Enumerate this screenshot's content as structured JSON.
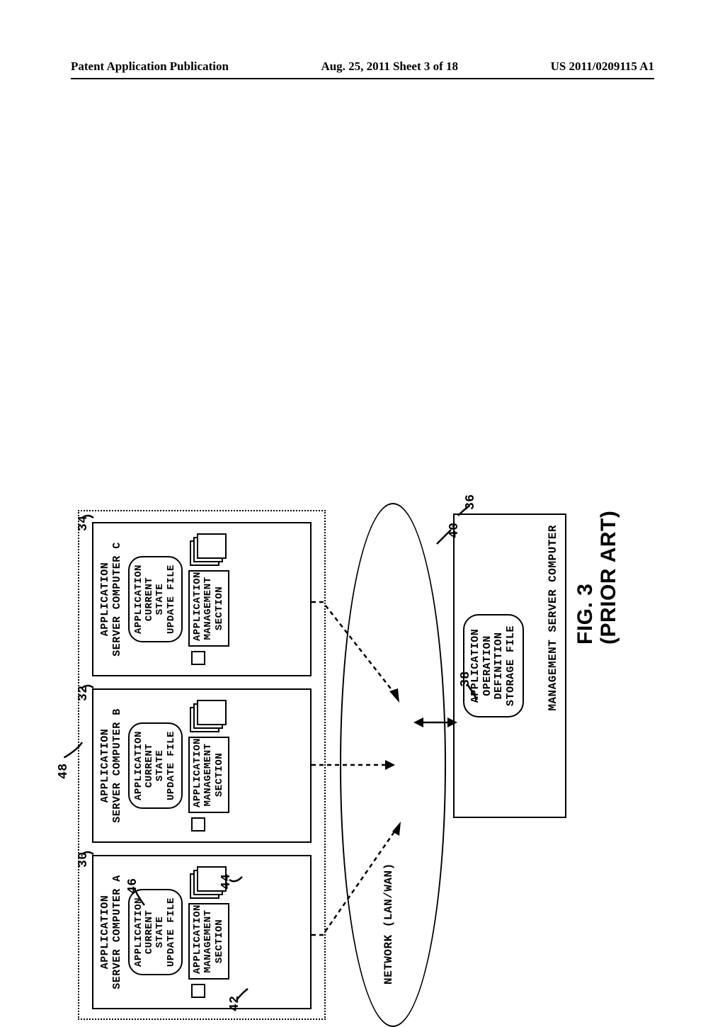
{
  "header": {
    "left": "Patent Application Publication",
    "center": "Aug. 25, 2011  Sheet 3 of 18",
    "right": "US 2011/0209115 A1"
  },
  "refs": {
    "group": "48",
    "serverA": "30",
    "serverB": "32",
    "serverC": "34",
    "mgmt_server": "36",
    "storage_file": "38",
    "network": "40",
    "small_box": "42",
    "stack": "44",
    "update_file": "46"
  },
  "labels": {
    "server_title_A": "APPLICATION\nSERVER COMPUTER A",
    "server_title_B": "APPLICATION\nSERVER COMPUTER B",
    "server_title_C": "APPLICATION\nSERVER COMPUTER C",
    "update_file": "APPLICATION\nCURRENT\nSTATE\nUPDATE FILE",
    "mgmt_section": "APPLICATION\nMANAGEMENT\nSECTION",
    "network": "NETWORK (LAN/WAN)",
    "mgmt_server": "MANAGEMENT SERVER COMPUTER",
    "storage_file": "APPLICATION\nOPERATION\nDEFINITION\nSTORAGE FILE"
  },
  "caption": {
    "fig": "FIG. 3",
    "sub": "(PRIOR ART)"
  },
  "chart_data": {
    "type": "diagram",
    "title": "FIG. 3 (PRIOR ART)",
    "nodes": [
      {
        "id": "48",
        "label": "Application server group (dashed)"
      },
      {
        "id": "30",
        "label": "Application Server Computer A"
      },
      {
        "id": "32",
        "label": "Application Server Computer B"
      },
      {
        "id": "34",
        "label": "Application Server Computer C"
      },
      {
        "id": "46",
        "label": "Application Current State Update File",
        "inside": [
          "30",
          "32",
          "34"
        ]
      },
      {
        "id": "42",
        "label": "small box",
        "inside": [
          "30",
          "32",
          "34"
        ]
      },
      {
        "id": "44",
        "label": "document stack",
        "inside": [
          "30",
          "32",
          "34"
        ]
      },
      {
        "id": "40",
        "label": "Network (LAN/WAN)"
      },
      {
        "id": "36",
        "label": "Management Server Computer"
      },
      {
        "id": "38",
        "label": "Application Operation Definition Storage File",
        "inside": [
          "36"
        ]
      }
    ],
    "edges": [
      {
        "from": "30",
        "to": "40",
        "style": "dashed"
      },
      {
        "from": "32",
        "to": "40",
        "style": "dashed"
      },
      {
        "from": "34",
        "to": "40",
        "style": "dashed"
      },
      {
        "from": "36",
        "to": "40",
        "style": "solid-bidir"
      }
    ]
  }
}
